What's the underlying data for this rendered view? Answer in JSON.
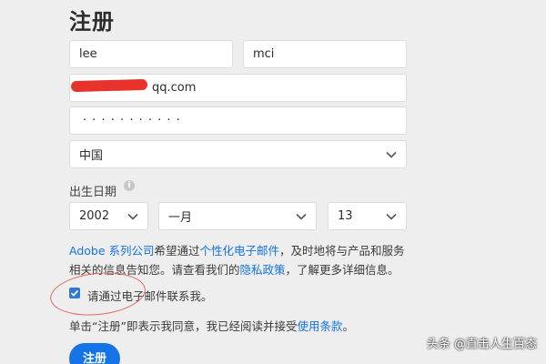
{
  "page": {
    "title": "注册"
  },
  "form": {
    "first_name": "lee",
    "last_name": "mci",
    "email_visible": "qq.com",
    "password_masked": "· · · · · · · · · · ·",
    "country": "中国",
    "dob_label": "出生日期",
    "dob_year": "2002",
    "dob_month": "一月",
    "dob_day": "13"
  },
  "notice": {
    "brand_link": "Adobe 系列公司",
    "text_1": "希望通过",
    "personalized_email_link": "个性化电子邮件",
    "text_2": "，及时地将与产品和服务相关的信息告知您。请查看我们的",
    "privacy_link": "隐私政策",
    "text_3": "，了解更多详细信息。"
  },
  "consent": {
    "checkbox_label": "请通过电子邮件联系我。",
    "checked": true
  },
  "terms": {
    "text": "单击“注册”即表示我同意，我已经阅读并接受",
    "link": "使用条款",
    "end": "。"
  },
  "submit": {
    "label": "注册"
  },
  "watermark": {
    "text": "头条 @直击人生百态"
  },
  "colors": {
    "accent": "#1473e6",
    "redaction": "#e8322c",
    "annotation_circle": "#e06a5b"
  }
}
